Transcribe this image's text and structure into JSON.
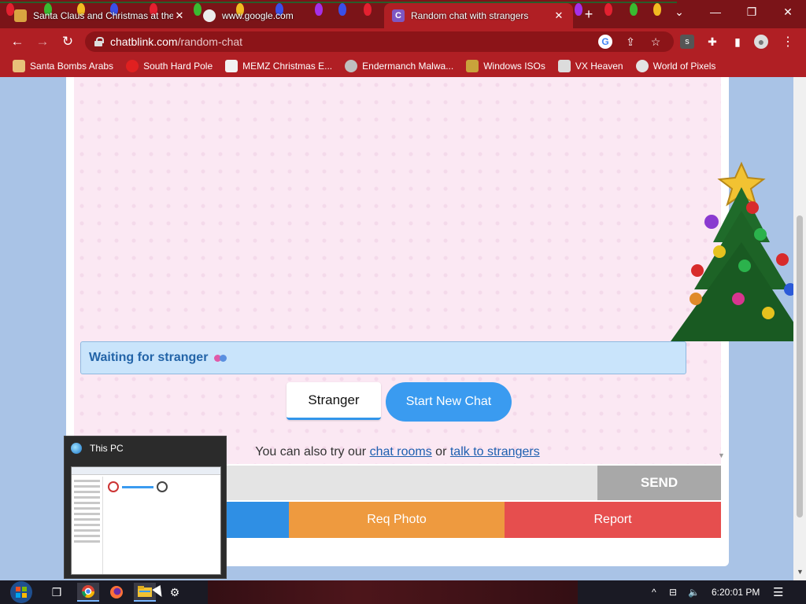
{
  "browser": {
    "tabs": [
      {
        "title": "Santa Claus and Christmas at the",
        "close": "✕"
      },
      {
        "title": "www.google.com",
        "close": ""
      },
      {
        "title": "Random chat with strangers",
        "close": "✕",
        "favicon_letter": "C"
      }
    ],
    "new_tab": "+",
    "window_controls": {
      "dropdown": "⌄",
      "minimize": "—",
      "restore": "❐",
      "close": "✕"
    },
    "nav": {
      "back": "←",
      "forward": "→",
      "reload": "↻"
    },
    "url_domain": "chatblink.com",
    "url_path": "/random-chat",
    "toolbar_icons": [
      "google-icon",
      "share-icon",
      "star-icon",
      "s-extension-icon",
      "puzzle-icon",
      "sidepanel-icon",
      "profile-icon",
      "menu-icon"
    ],
    "toolbar_glyphs": {
      "share": "⇪",
      "star": "☆",
      "extension_letter": "s",
      "puzzle": "✚",
      "sidepanel": "▮",
      "profile": "●",
      "menu": "⋮"
    },
    "bookmarks": [
      {
        "label": "Santa Bombs Arabs",
        "color": "#e8c07a"
      },
      {
        "label": "South Hard Pole",
        "color": "#e02020"
      },
      {
        "label": "MEMZ Christmas E...",
        "color": "#f2f2f2"
      },
      {
        "label": "Endermanch Malwa...",
        "color": "#bfbfbf"
      },
      {
        "label": "Windows ISOs",
        "color": "#c9a33b"
      },
      {
        "label": "VX Heaven",
        "color": "#dcdcdc"
      },
      {
        "label": "World of Pixels",
        "color": "#e3e3e3"
      }
    ]
  },
  "chat": {
    "status": "Waiting for stranger",
    "stranger_button": "Stranger",
    "new_chat_button": "Start New Chat",
    "alt_prefix": "You can also try our",
    "alt_link1": "chat rooms",
    "alt_mid": "or",
    "alt_link2": "talk to strangers",
    "scroll_arrow": "▼",
    "message_input_value": "",
    "send_button": "SEND",
    "req_photo_button": "Req Photo",
    "report_button": "Report"
  },
  "thumbnail": {
    "title": "This PC"
  },
  "taskbar": {
    "time": "6:20:01 PM",
    "tray": {
      "chevron": "^",
      "network": "⊟",
      "volume": "🔈",
      "notifications": "☰"
    },
    "taskview_glyph": "❒",
    "settings_glyph": "⚙"
  },
  "scrollbar_arrow": "▼",
  "colors": {
    "tabstrip": "#7b1418",
    "toolbar": "#b01f24",
    "status_text": "#2364a8",
    "send_disabled": "#a8a8a8",
    "req_photo": "#ee9a3f",
    "report": "#e64e4e",
    "start_new_chat": "#3a9bf0"
  }
}
